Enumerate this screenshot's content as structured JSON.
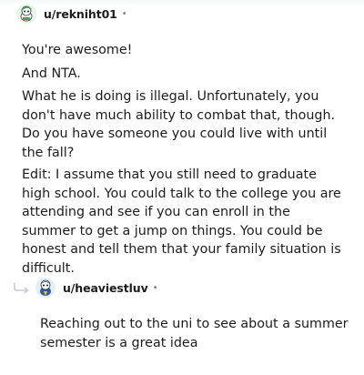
{
  "comment": {
    "username": "u/rekniht01",
    "separator": "•",
    "avatar_icon": "snoo-avatar-green-icon",
    "paragraphs": [
      "You're awesome!",
      "And NTA.",
      "What he is doing is illegal. Unfortunately, you don't have much ability to combat that, though. Do you have someone you could live with until the fall?",
      "Edit: I assume that you still need to graduate high school. You could talk to the college you are attending and see if you can enroll in the summer to get a jump on things. You could be honest and tell them that your family situation is difficult."
    ]
  },
  "reply": {
    "username": "u/heaviestluv",
    "separator": "•",
    "avatar_icon": "snoo-avatar-blue-icon",
    "reply_icon": "reply-arrow-icon",
    "paragraphs": [
      "Reaching out to the uni to see about a summer semester is a great idea"
    ]
  },
  "colors": {
    "text": "#1c1c1c",
    "meta": "#7c7c7c",
    "thread_line": "#c8cbcd"
  }
}
